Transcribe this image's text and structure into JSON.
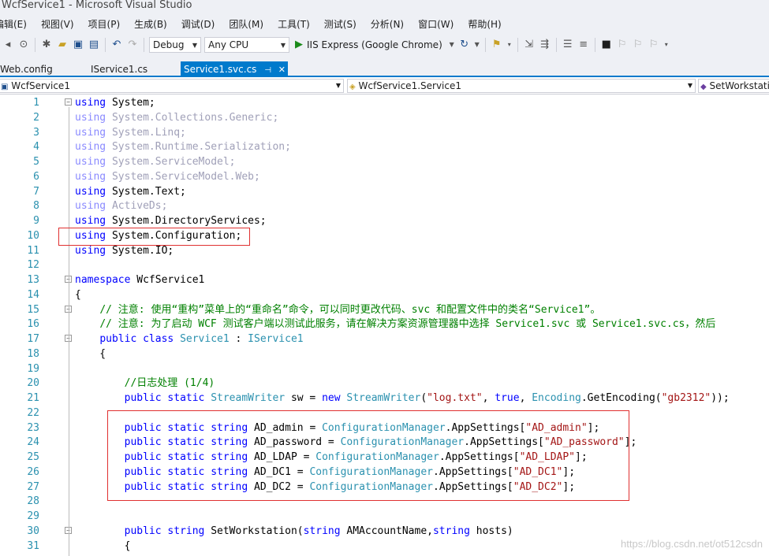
{
  "window": {
    "title": "WcfService1 - Microsoft Visual Studio"
  },
  "menu": [
    "编辑(E)",
    "视图(V)",
    "项目(P)",
    "生成(B)",
    "调试(D)",
    "团队(M)",
    "工具(T)",
    "测试(S)",
    "分析(N)",
    "窗口(W)",
    "帮助(H)"
  ],
  "toolbar": {
    "config": "Debug",
    "platform": "Any CPU",
    "run_label": "IIS Express (Google Chrome)"
  },
  "tabs": [
    {
      "label": "Web.config",
      "active": false
    },
    {
      "label": "IService1.cs",
      "active": false
    },
    {
      "label": "Service1.svc.cs",
      "active": true
    }
  ],
  "tab_pin": "⊣",
  "tab_close": "✕",
  "navbar": {
    "project": "WcfService1",
    "class": "WcfService1.Service1",
    "member": "SetWorkstation"
  },
  "code_lines": [
    {
      "n": "1",
      "fold": "−",
      "html": "<span class='kw'>using</span> System;"
    },
    {
      "n": "2",
      "html": "<span class='dimkw'>using</span> <span class='dim'>System.Collections.Generic;</span>"
    },
    {
      "n": "3",
      "html": "<span class='dimkw'>using</span> <span class='dim'>System.Linq;</span>"
    },
    {
      "n": "4",
      "html": "<span class='dimkw'>using</span> <span class='dim'>System.Runtime.Serialization;</span>"
    },
    {
      "n": "5",
      "html": "<span class='dimkw'>using</span> <span class='dim'>System.ServiceModel;</span>"
    },
    {
      "n": "6",
      "html": "<span class='dimkw'>using</span> <span class='dim'>System.ServiceModel.Web;</span>"
    },
    {
      "n": "7",
      "html": "<span class='kw'>using</span> System.Text;"
    },
    {
      "n": "8",
      "html": "<span class='dimkw'>using</span> <span class='dim'>ActiveDs;</span>"
    },
    {
      "n": "9",
      "html": "<span class='kw'>using</span> System.DirectoryServices;"
    },
    {
      "n": "10",
      "html": "<span class='kw'>using</span> System.Configuration;"
    },
    {
      "n": "11",
      "html": "<span class='kw'>using</span> System.IO;"
    },
    {
      "n": "12",
      "html": ""
    },
    {
      "n": "13",
      "fold": "−",
      "html": "<span class='kw'>namespace</span> WcfService1"
    },
    {
      "n": "14",
      "html": "{"
    },
    {
      "n": "15",
      "fold": "−",
      "html": "    <span class='cm'>// 注意: 使用“重构”菜单上的“重命名”命令，可以同时更改代码、svc 和配置文件中的类名“Service1”。</span>"
    },
    {
      "n": "16",
      "html": "    <span class='cm'>// 注意: 为了启动 WCF 测试客户端以测试此服务，请在解决方案资源管理器中选择 Service1.svc 或 Service1.svc.cs，然后</span>"
    },
    {
      "n": "17",
      "fold": "−",
      "html": "    <span class='kw'>public class</span> <span class='ty'>Service1</span> : <span class='ty'>IService1</span>"
    },
    {
      "n": "18",
      "html": "    {"
    },
    {
      "n": "19",
      "html": ""
    },
    {
      "n": "20",
      "html": "        <span class='cm'>//日志处理 (1/4)</span>"
    },
    {
      "n": "21",
      "html": "        <span class='kw'>public static</span> <span class='ty'>StreamWriter</span> sw = <span class='kw'>new</span> <span class='ty'>StreamWriter</span>(<span class='str'>\"log.txt\"</span>, <span class='kw'>true</span>, <span class='ty'>Encoding</span>.GetEncoding(<span class='str'>\"gb2312\"</span>));"
    },
    {
      "n": "22",
      "html": ""
    },
    {
      "n": "23",
      "html": "        <span class='kw'>public static string</span> AD_admin = <span class='ty'>ConfigurationManager</span>.AppSettings[<span class='str'>\"AD_admin\"</span>];"
    },
    {
      "n": "24",
      "html": "        <span class='kw'>public static string</span> AD_password = <span class='ty'>ConfigurationManager</span>.AppSettings[<span class='str'>\"AD_password\"</span>];"
    },
    {
      "n": "25",
      "html": "        <span class='kw'>public static string</span> AD_LDAP = <span class='ty'>ConfigurationManager</span>.AppSettings[<span class='str'>\"AD_LDAP\"</span>];"
    },
    {
      "n": "26",
      "html": "        <span class='kw'>public static string</span> AD_DC1 = <span class='ty'>ConfigurationManager</span>.AppSettings[<span class='str'>\"AD_DC1\"</span>];"
    },
    {
      "n": "27",
      "html": "        <span class='kw'>public static string</span> AD_DC2 = <span class='ty'>ConfigurationManager</span>.AppSettings[<span class='str'>\"AD_DC2\"</span>];"
    },
    {
      "n": "28",
      "html": ""
    },
    {
      "n": "29",
      "html": ""
    },
    {
      "n": "30",
      "fold": "−",
      "html": "        <span class='kw'>public string</span> SetWorkstation(<span class='kw'>string</span> AMAccountName,<span class='kw'>string</span> hosts)"
    },
    {
      "n": "31",
      "html": "        {"
    }
  ],
  "watermark": "https://blog.csdn.net/ot512csdn"
}
